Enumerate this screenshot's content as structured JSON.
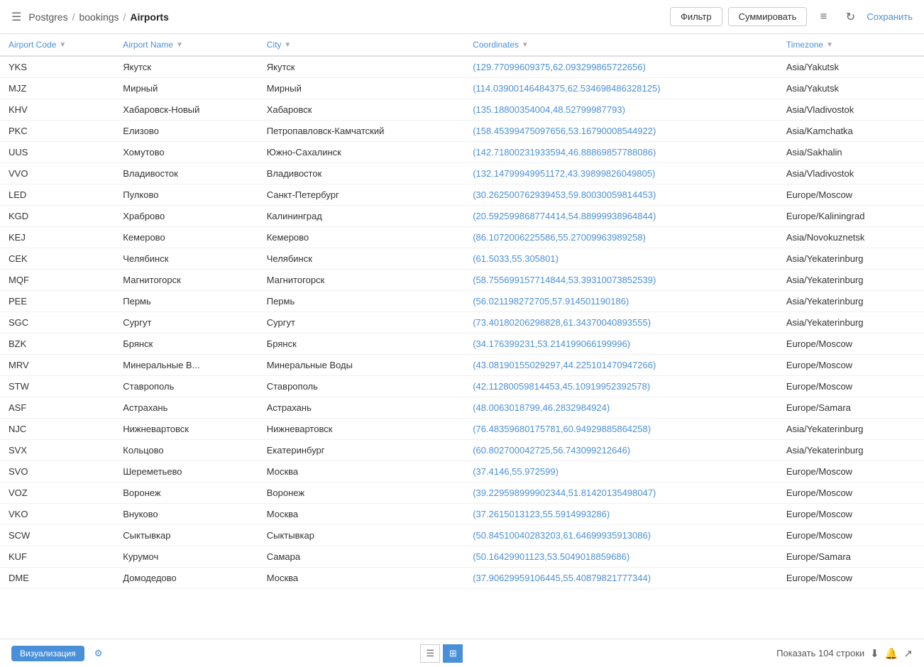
{
  "header": {
    "db_label": "Postgres",
    "sep1": "/",
    "schema_label": "bookings",
    "sep2": "/",
    "table_label": "Airports",
    "filter_btn": "Фильтр",
    "summarize_btn": "Суммировать",
    "save_btn": "Сохранить"
  },
  "columns": [
    {
      "key": "code",
      "label": "Airport Code"
    },
    {
      "key": "name",
      "label": "Airport Name"
    },
    {
      "key": "city",
      "label": "City"
    },
    {
      "key": "coords",
      "label": "Coordinates"
    },
    {
      "key": "tz",
      "label": "Timezone"
    }
  ],
  "rows": [
    {
      "code": "YKS",
      "name": "Якутск",
      "city": "Якутск",
      "coords": "(129.77099609375,62.093299865722656)",
      "tz": "Asia/Yakutsk"
    },
    {
      "code": "MJZ",
      "name": "Мирный",
      "city": "Мирный",
      "coords": "(114.03900146484375,62.534698486328125)",
      "tz": "Asia/Yakutsk"
    },
    {
      "code": "KHV",
      "name": "Хабаровск-Новый",
      "city": "Хабаровск",
      "coords": "(135.18800354004,48.52799987793)",
      "tz": "Asia/Vladivostok"
    },
    {
      "code": "PKC",
      "name": "Елизово",
      "city": "Петропавловск-Камчатский",
      "coords": "(158.45399475097656,53.16790008544922)",
      "tz": "Asia/Kamchatka"
    },
    {
      "code": "UUS",
      "name": "Хомутово",
      "city": "Южно-Сахалинск",
      "coords": "(142.71800231933594,46.88869857788086)",
      "tz": "Asia/Sakhalin"
    },
    {
      "code": "VVO",
      "name": "Владивосток",
      "city": "Владивосток",
      "coords": "(132.14799949951172,43.39899826049805)",
      "tz": "Asia/Vladivostok"
    },
    {
      "code": "LED",
      "name": "Пулково",
      "city": "Санкт-Петербург",
      "coords": "(30.262500762939453,59.80030059814453)",
      "tz": "Europe/Moscow"
    },
    {
      "code": "KGD",
      "name": "Храброво",
      "city": "Калининград",
      "coords": "(20.592599868774414,54.88999938964844)",
      "tz": "Europe/Kaliningrad"
    },
    {
      "code": "KEJ",
      "name": "Кемерово",
      "city": "Кемерово",
      "coords": "(86.1072006225586,55.27009963989258)",
      "tz": "Asia/Novokuznetsk"
    },
    {
      "code": "CEK",
      "name": "Челябинск",
      "city": "Челябинск",
      "coords": "(61.5033,55.305801)",
      "tz": "Asia/Yekaterinburg"
    },
    {
      "code": "MQF",
      "name": "Магнитогорск",
      "city": "Магнитогорск",
      "coords": "(58.755699157714844,53.39310073852539)",
      "tz": "Asia/Yekaterinburg"
    },
    {
      "code": "PEE",
      "name": "Пермь",
      "city": "Пермь",
      "coords": "(56.021198272705,57.914501190186)",
      "tz": "Asia/Yekaterinburg"
    },
    {
      "code": "SGC",
      "name": "Сургут",
      "city": "Сургут",
      "coords": "(73.40180206298828,61.34370040893555)",
      "tz": "Asia/Yekaterinburg"
    },
    {
      "code": "BZK",
      "name": "Брянск",
      "city": "Брянск",
      "coords": "(34.176399231,53.214199066199996)",
      "tz": "Europe/Moscow"
    },
    {
      "code": "MRV",
      "name": "Минеральные В...",
      "city": "Минеральные Воды",
      "coords": "(43.08190155029297,44.225101470947266)",
      "tz": "Europe/Moscow"
    },
    {
      "code": "STW",
      "name": "Ставрополь",
      "city": "Ставрополь",
      "coords": "(42.11280059814453,45.10919952392578)",
      "tz": "Europe/Moscow"
    },
    {
      "code": "ASF",
      "name": "Астрахань",
      "city": "Астрахань",
      "coords": "(48.0063018799,46.2832984924)",
      "tz": "Europe/Samara"
    },
    {
      "code": "NJC",
      "name": "Нижневартовск",
      "city": "Нижневартовск",
      "coords": "(76.48359680175781,60.94929885864258)",
      "tz": "Asia/Yekaterinburg"
    },
    {
      "code": "SVX",
      "name": "Кольцово",
      "city": "Екатеринбург",
      "coords": "(60.802700042725,56.743099212646)",
      "tz": "Asia/Yekaterinburg"
    },
    {
      "code": "SVO",
      "name": "Шереметьево",
      "city": "Москва",
      "coords": "(37.4146,55.972599)",
      "tz": "Europe/Moscow"
    },
    {
      "code": "VOZ",
      "name": "Воронеж",
      "city": "Воронеж",
      "coords": "(39.229598999902344,51.81420135498047)",
      "tz": "Europe/Moscow"
    },
    {
      "code": "VKO",
      "name": "Внуково",
      "city": "Москва",
      "coords": "(37.2615013123,55.5914993286)",
      "tz": "Europe/Moscow"
    },
    {
      "code": "SCW",
      "name": "Сыктывкар",
      "city": "Сыктывкар",
      "coords": "(50.84510040283203,61.64699935913086)",
      "tz": "Europe/Moscow"
    },
    {
      "code": "KUF",
      "name": "Курумоч",
      "city": "Самара",
      "coords": "(50.16429901123,53.5049018859686)",
      "tz": "Europe/Samara"
    },
    {
      "code": "DME",
      "name": "Домодедово",
      "city": "Москва",
      "coords": "(37.90629959106445,55.40879821777344)",
      "tz": "Europe/Moscow"
    }
  ],
  "footer": {
    "visualize_btn": "Визуализация",
    "row_count": "Показать 104 строки"
  }
}
